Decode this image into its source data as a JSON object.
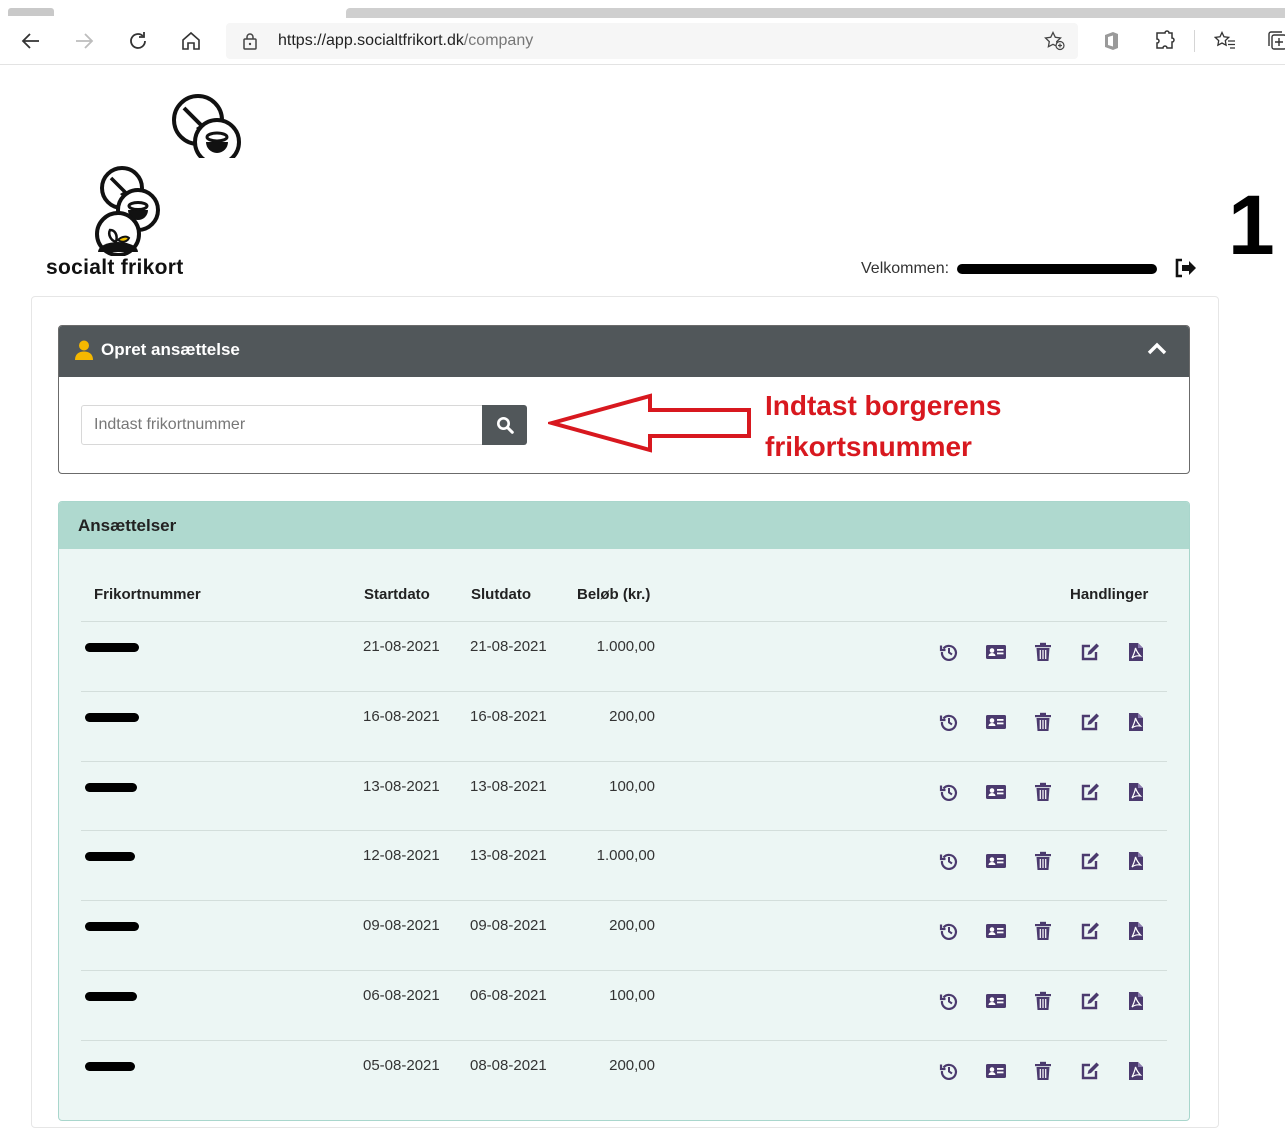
{
  "browser": {
    "url_main": "https://app.socialtfrikort.dk",
    "url_path": "/company"
  },
  "header": {
    "logo_text": "socialt frikort",
    "welcome_label": "Velkommen:",
    "step_number": "1"
  },
  "create_panel": {
    "title": "Opret ansættelse",
    "search_placeholder": "Indtast frikortnummer"
  },
  "annotation": {
    "line1": "Indtast borgerens",
    "line2": "frikortsnummer",
    "color": "#d8181f"
  },
  "employments": {
    "title": "Ansættelser",
    "columns": {
      "number": "Frikortnummer",
      "start": "Startdato",
      "end": "Slutdato",
      "amount": "Beløb (kr.)",
      "actions": "Handlinger"
    },
    "rows": [
      {
        "start": "21-08-2021",
        "end": "21-08-2021",
        "amount": "1.000,00"
      },
      {
        "start": "16-08-2021",
        "end": "16-08-2021",
        "amount": "200,00"
      },
      {
        "start": "13-08-2021",
        "end": "13-08-2021",
        "amount": "100,00"
      },
      {
        "start": "12-08-2021",
        "end": "13-08-2021",
        "amount": "1.000,00"
      },
      {
        "start": "09-08-2021",
        "end": "09-08-2021",
        "amount": "200,00"
      },
      {
        "start": "06-08-2021",
        "end": "06-08-2021",
        "amount": "100,00"
      },
      {
        "start": "05-08-2021",
        "end": "08-08-2021",
        "amount": "200,00"
      }
    ],
    "action_icons": [
      "history-icon",
      "id-card-icon",
      "trash-icon",
      "edit-icon",
      "pdf-icon"
    ]
  },
  "colors": {
    "panel_header": "#51575a",
    "table_header": "#afd9cf",
    "table_body": "#ecf6f4",
    "action_icon": "#4b3a6e",
    "user_icon": "#f5b800"
  }
}
